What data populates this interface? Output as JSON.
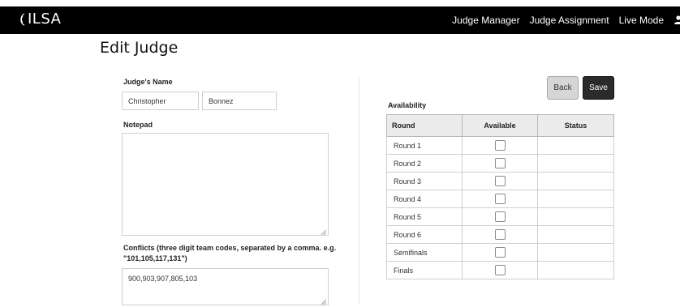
{
  "header": {
    "brand": "ILSA",
    "nav": [
      "Judge Manager",
      "Judge Assignment",
      "Live Mode"
    ]
  },
  "page": {
    "title": "Edit Judge"
  },
  "form": {
    "name_label": "Judge's Name",
    "first_name": "Christopher",
    "last_name": "Bonnez",
    "notepad_label": "Notepad",
    "notepad_value": "",
    "conflicts_label_line1": "Conflicts (three digit team codes, separated by a comma. e.g.",
    "conflicts_label_line2": "\"101,105,117,131\")",
    "conflicts_value": "900,903,907,805,103"
  },
  "actions": {
    "back_label": "Back",
    "save_label": "Save"
  },
  "availability": {
    "title": "Availability",
    "columns": [
      "Round",
      "Available",
      "Status"
    ],
    "rows": [
      {
        "round": "Round 1",
        "available": false,
        "status": ""
      },
      {
        "round": "Round 2",
        "available": false,
        "status": ""
      },
      {
        "round": "Round 3",
        "available": false,
        "status": ""
      },
      {
        "round": "Round 4",
        "available": false,
        "status": ""
      },
      {
        "round": "Round 5",
        "available": false,
        "status": ""
      },
      {
        "round": "Round 6",
        "available": false,
        "status": ""
      },
      {
        "round": "Semifinals",
        "available": false,
        "status": ""
      },
      {
        "round": "Finals",
        "available": false,
        "status": ""
      }
    ]
  },
  "colors": {
    "topbar": "#000000",
    "save_button": "#2b2b2b",
    "back_button": "#d6d6d6",
    "table_header": "#ececec"
  },
  "icons": [
    "logo-mark-icon",
    "user-icon",
    "resize-handle-icon"
  ]
}
